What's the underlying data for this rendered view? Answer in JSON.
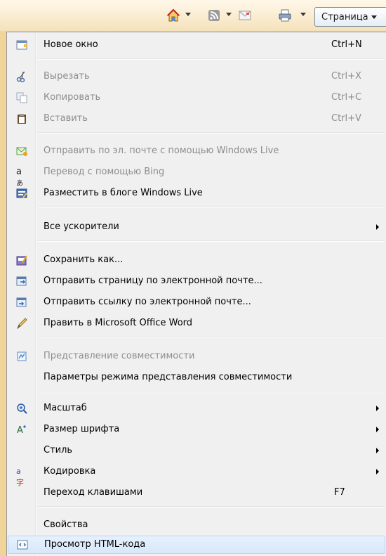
{
  "toolbar": {
    "icons": [
      "home-icon",
      "rss-feed-icon",
      "read-mail-icon",
      "print-icon"
    ],
    "page_button_label": "Страница"
  },
  "menu": {
    "items": [
      {
        "label": "Новое окно",
        "shortcut": "Ctrl+N",
        "icon": "new-window-icon"
      },
      {
        "label": "Вырезать",
        "shortcut": "Ctrl+X",
        "icon": "cut-icon"
      },
      {
        "label": "Копировать",
        "shortcut": "Ctrl+C",
        "icon": "copy-icon"
      },
      {
        "label": "Вставить",
        "shortcut": "Ctrl+V",
        "icon": "paste-icon"
      },
      {
        "label": "Отправить по эл. почте с помощью Windows Live",
        "icon": "email-windows-live-icon"
      },
      {
        "label": "Перевод с помощью Bing",
        "icon": "translate-icon"
      },
      {
        "label": "Разместить в блоге Windows Live",
        "icon": "blog-icon"
      },
      {
        "label": "Все ускорители"
      },
      {
        "label": "Сохранить как...",
        "icon": "save-as-icon"
      },
      {
        "label": "Отправить страницу по электронной почте...",
        "icon": "send-page-icon"
      },
      {
        "label": "Отправить ссылку по электронной почте...",
        "icon": "send-link-icon"
      },
      {
        "label": "Править в Microsoft Office Word",
        "icon": "edit-pencil-icon"
      },
      {
        "label": "Представление совместимости",
        "icon": "compatibility-view-icon"
      },
      {
        "label": "Параметры режима представления совместимости"
      },
      {
        "label": "Масштаб",
        "icon": "zoom-icon"
      },
      {
        "label": "Размер шрифта",
        "icon": "font-size-icon"
      },
      {
        "label": "Стиль"
      },
      {
        "label": "Кодировка",
        "icon": "encoding-icon"
      },
      {
        "label": "Переход клавишами",
        "shortcut": "F7"
      },
      {
        "label": "Свойства"
      },
      {
        "label": "Просмотр HTML-кода",
        "icon": "view-source-icon"
      }
    ]
  },
  "colors": {
    "background": "#f1d49a",
    "menu_background": "#f0f0f0",
    "disabled_text": "#8d8d8d",
    "hover_background": "#dde9f8"
  }
}
